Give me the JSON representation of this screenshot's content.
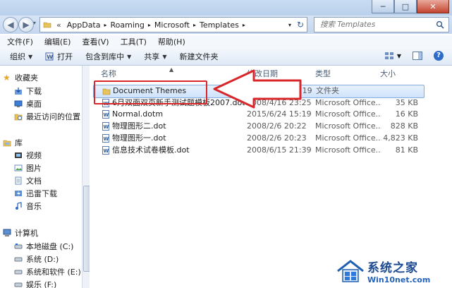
{
  "window": {
    "min_label": "─",
    "max_label": "□",
    "close_label": "✕"
  },
  "nav": {
    "back_glyph": "◀",
    "forward_glyph": "▶",
    "recent_glyph": "▾",
    "address_prefix": "«",
    "breadcrumb": [
      "AppData",
      "Roaming",
      "Microsoft",
      "Templates"
    ],
    "separator": "▸",
    "address_dropdown": "▾",
    "refresh_glyph": "↻",
    "search_placeholder": "搜索 Templates",
    "search_icon": "magnifier-icon"
  },
  "menu": [
    "文件(F)",
    "编辑(E)",
    "查看(V)",
    "工具(T)",
    "帮助(H)"
  ],
  "toolbar": {
    "organize": "组织",
    "open": "打开",
    "include": "包含到库中",
    "share": "共享",
    "new_folder": "新建文件夹",
    "dd": "▼"
  },
  "sidebar": {
    "favorites": {
      "label": "收藏夹",
      "items": [
        "下载",
        "桌面",
        "最近访问的位置"
      ]
    },
    "libraries": {
      "label": "库",
      "items": [
        "视频",
        "图片",
        "文档",
        "迅雷下载",
        "音乐"
      ]
    },
    "computer": {
      "label": "计算机",
      "items": [
        "本地磁盘 (C:)",
        "系统 (D:)",
        "系统和软件 (E:)",
        "娱乐 (F:)"
      ]
    }
  },
  "columns": {
    "name": "名称",
    "date": "修改日期",
    "type": "类型",
    "size": "大小",
    "sort_caret": "▲"
  },
  "files": [
    {
      "name": "Document Themes",
      "date": "2015/6/24 15:19",
      "type": "文件夹",
      "size": "",
      "icon": "folder-icon",
      "selected": true
    },
    {
      "name": "6月双面双页新手测试题模板2007.dotx",
      "date": "2008/4/16 23:25",
      "type": "Microsoft Office...",
      "size": "35 KB",
      "icon": "word-template-icon",
      "selected": false
    },
    {
      "name": "Normal.dotm",
      "date": "2015/6/24 15:19",
      "type": "Microsoft Office...",
      "size": "16 KB",
      "icon": "word-template-icon",
      "selected": false
    },
    {
      "name": "物理图形二.dot",
      "date": "2008/2/6 20:22",
      "type": "Microsoft Office...",
      "size": "828 KB",
      "icon": "word-template-icon",
      "selected": false
    },
    {
      "name": "物理图形一.dot",
      "date": "2008/2/6 20:23",
      "type": "Microsoft Office...",
      "size": "4,823 KB",
      "icon": "word-template-icon",
      "selected": false
    },
    {
      "name": "信息技术试卷模板.dot",
      "date": "2008/6/15 21:39",
      "type": "Microsoft Office...",
      "size": "81 KB",
      "icon": "word-template-icon",
      "selected": false
    }
  ],
  "watermark": {
    "line1": "系统之家",
    "line2": "Win10net.com"
  },
  "colors": {
    "highlight": "#d9262a",
    "selection": "#cfe3fb",
    "folder": "#e8c25a"
  }
}
